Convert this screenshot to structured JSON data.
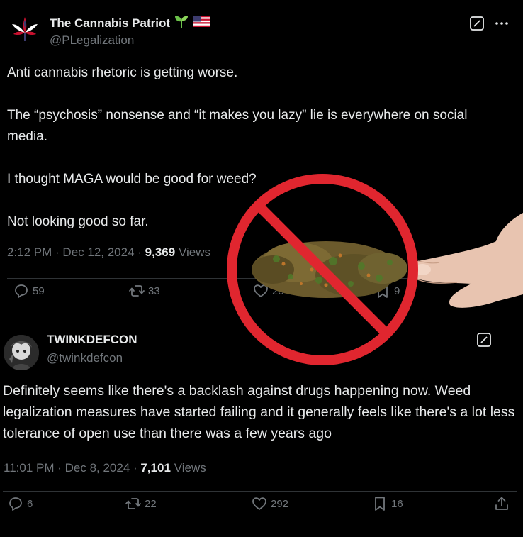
{
  "tweet1": {
    "display_name": "The Cannabis Patriot",
    "name_emojis": [
      "seedling-icon",
      "us-flag-icon"
    ],
    "handle": "@PLegalization",
    "text": "Anti cannabis rhetoric is getting worse.\n\nThe “psychosis” nonsense and “it makes you lazy” lie is everywhere on social media.\n\nI thought MAGA would be good for weed?\n\nNot looking good so far.",
    "time": "2:12 PM · Dec 12, 2024 ·",
    "views_count": "9,369",
    "views_label": "Views",
    "replies": "59",
    "reposts": "33",
    "likes": "23",
    "bookmarks": "9"
  },
  "tweet2": {
    "display_name": "TWINKDEFCON",
    "handle": "@twinkdefcon",
    "text": "Definitely seems like there's a backlash against drugs happening now. Weed legalization measures have started failing and it generally feels like there's a lot less tolerance of open use than there was a few years ago",
    "time": "11:01 PM · Dec 8, 2024 ·",
    "views_count": "7,101",
    "views_label": "Views",
    "replies": "6",
    "reposts": "22",
    "likes": "292",
    "bookmarks": "16"
  },
  "colors": {
    "background": "#000000",
    "text_primary": "#e7e9ea",
    "text_secondary": "#71767b",
    "divider": "#2f3336",
    "prohibition_red": "#e0262f",
    "seedling_green": "#6cc24a"
  },
  "overlay": {
    "description_icon": "no-cannabis-prohibition-icon"
  }
}
